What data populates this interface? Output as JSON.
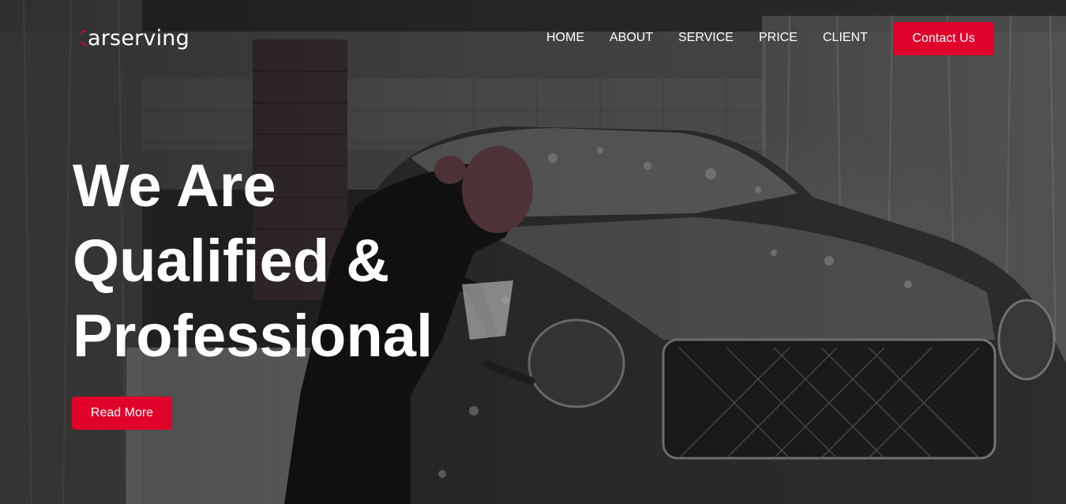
{
  "brand": {
    "logo_text": "arserving",
    "logo_initial_color": "#e0022a"
  },
  "nav": {
    "items": [
      {
        "label": "HOME"
      },
      {
        "label": "ABOUT"
      },
      {
        "label": "SERVICE"
      },
      {
        "label": "PRICE"
      },
      {
        "label": "CLIENT"
      }
    ],
    "contact_label": "Contact Us"
  },
  "hero": {
    "headline_lines": [
      "We Are",
      "Qualified &",
      "Professional"
    ],
    "cta_label": "Read More",
    "background_image": "photo of a woman washing a black foam-covered luxury car in a garage"
  },
  "colors": {
    "accent": "#e0022a",
    "text": "#ffffff"
  }
}
